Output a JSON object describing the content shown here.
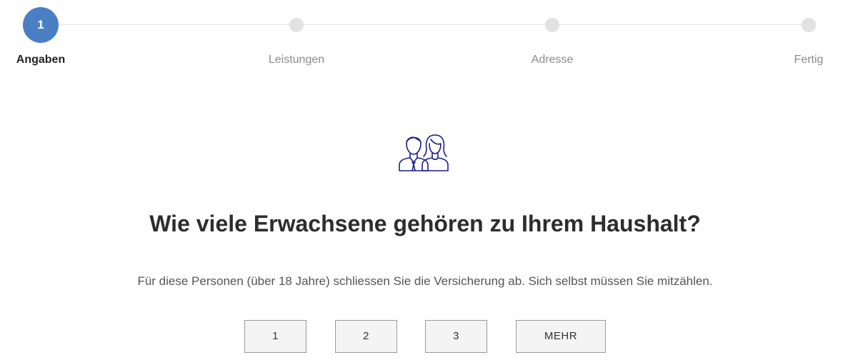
{
  "stepper": {
    "steps": [
      {
        "number": "1",
        "label": "Angaben",
        "state": "active"
      },
      {
        "number": "",
        "label": "Leistungen",
        "state": "pending"
      },
      {
        "number": "",
        "label": "Adresse",
        "state": "pending"
      },
      {
        "number": "",
        "label": "Fertig",
        "state": "pending"
      }
    ]
  },
  "hero": {
    "icon": "two-adults-icon",
    "icon_color": "#1c1c8a"
  },
  "question": {
    "title": "Wie viele Erwachsene gehören zu Ihrem Haushalt?",
    "hint": "Für diese Personen (über 18 Jahre) schliessen Sie die Versicherung ab. Sich selbst müssen Sie mitzählen."
  },
  "answers": {
    "options": [
      "1",
      "2",
      "3",
      "MEHR"
    ]
  },
  "colors": {
    "accent": "#4a7fc4",
    "inactive_dot": "#e2e2e2"
  }
}
